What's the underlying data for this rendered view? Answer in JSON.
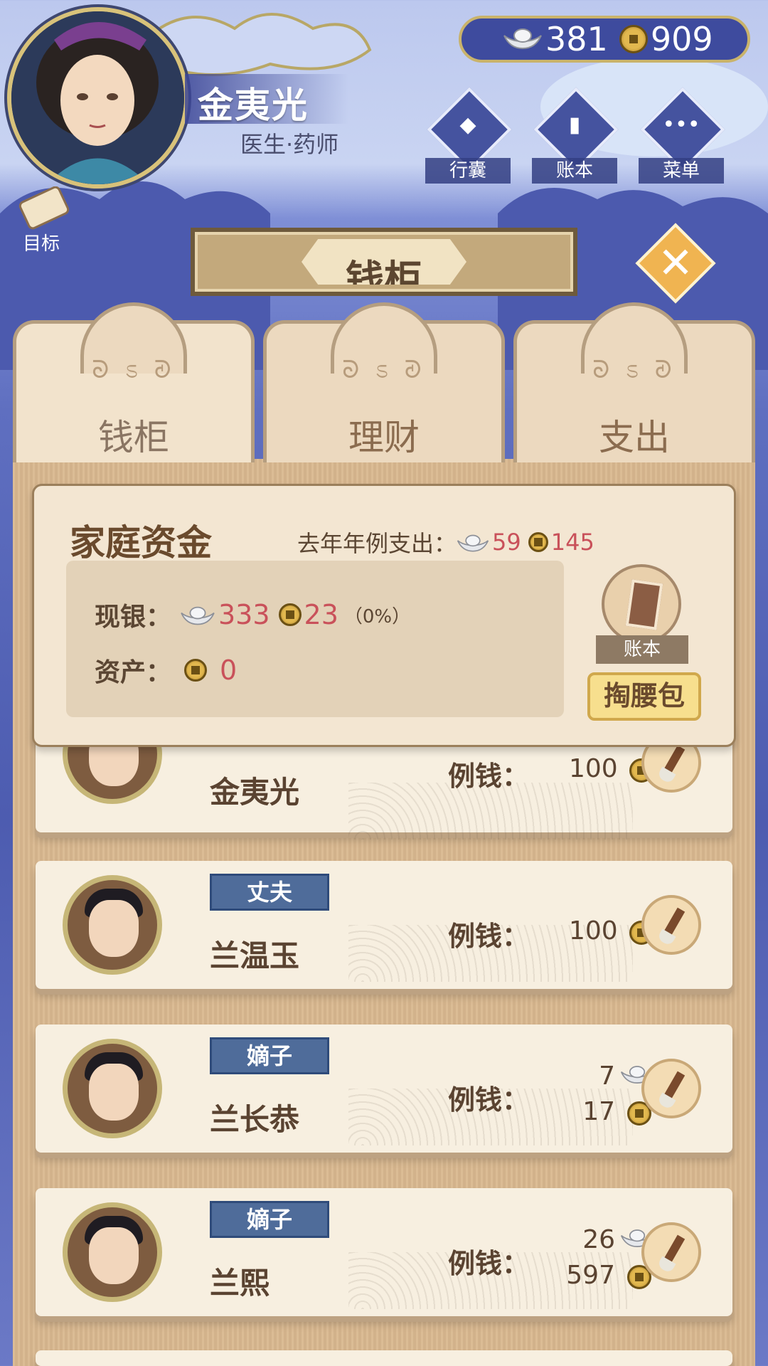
{
  "player": {
    "name": "金夷光",
    "title": "医生·药师"
  },
  "currency": {
    "silver": "381",
    "coins": "909"
  },
  "top_buttons": {
    "bag": "行囊",
    "ledger": "账本",
    "menu": "菜单"
  },
  "goal_label": "目标",
  "page_title": "钱柜",
  "tabs": [
    "钱柜",
    "理财",
    "支出"
  ],
  "fund": {
    "title": "家庭资金",
    "last_year_label": "去年年例支出：",
    "last_year_silver": "59",
    "last_year_coins": "145",
    "cash_label": "现银：",
    "cash_silver": "333",
    "cash_coins": "23",
    "cash_pct": "（0%）",
    "assets_label": "资产：",
    "assets_value": "0",
    "ledger_label": "账本",
    "pocket_button": "掏腰包"
  },
  "members": [
    {
      "role": "",
      "name": "金夷光",
      "allowance_label": "例钱：",
      "silver": "",
      "coins": "100"
    },
    {
      "role": "丈夫",
      "name": "兰温玉",
      "allowance_label": "例钱：",
      "silver": "",
      "coins": "100"
    },
    {
      "role": "嫡子",
      "name": "兰长恭",
      "allowance_label": "例钱：",
      "silver": "7",
      "coins": "17"
    },
    {
      "role": "嫡子",
      "name": "兰熙",
      "allowance_label": "例钱：",
      "silver": "26",
      "coins": "597"
    }
  ],
  "colors": {
    "accent_red": "#c9515a",
    "role_tag": "#4f6c9a",
    "panel_wood": "#d9b88f",
    "sky_blue": "#5f6fc0"
  }
}
